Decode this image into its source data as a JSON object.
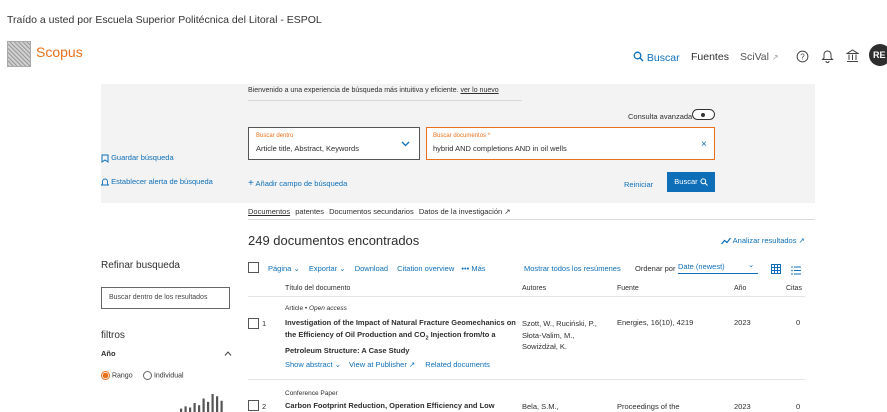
{
  "courtesy": "Traído a usted por Escuela Superior Politécnica del Litoral - ESPOL",
  "brand": {
    "name": "Scopus",
    "accent": "#e9711c",
    "primary": "#0e6fb8"
  },
  "topnav": {
    "search": "Buscar",
    "sources": "Fuentes",
    "scival": "SciVal",
    "scival_arrow": "↗",
    "avatar": "RE"
  },
  "banner": {
    "text": "Bienvenido a una experiencia de búsqueda más intuitiva y eficiente.",
    "link": "ver lo nuevo"
  },
  "advanced": {
    "label": "Consulta avanzada"
  },
  "search": {
    "within_label": "Buscar dentro",
    "within_value": "Article title, Abstract, Keywords",
    "docs_label": "Buscar documentos *",
    "docs_value": "hybrid AND completions AND in oil wells",
    "add_field": "Añadir campo de búsqueda",
    "reset": "Reiniciar",
    "submit": "Buscar"
  },
  "left": {
    "save_search": "Guardar búsqueda",
    "set_alert": "Establecer alerta de búsqueda",
    "refine_title": "Refinar busqueda",
    "refine_placeholder": "Buscar dentro de los resultados",
    "filters": "filtros",
    "year": "Año",
    "range": "Rango",
    "individual": "Individual"
  },
  "tabs": [
    "Documentos",
    "patentes",
    "Documentos secundarios",
    "Datos de la investigación ↗"
  ],
  "results": {
    "count_text": "249 documentos encontrados",
    "analyze": "Analizar resultados ↗",
    "toolbar": {
      "page": "Página",
      "export": "Exportar",
      "download": "Download",
      "citation": "Citation overview",
      "more": "Más",
      "show_all": "Mostrar todos los resúmenes",
      "sort_label": "Ordenar por",
      "sort_value": "Date (newest)"
    },
    "columns": [
      "Título del documento",
      "Autores",
      "Fuente",
      "Año",
      "Citas"
    ],
    "rows": [
      {
        "num": "1",
        "type": "Article",
        "access": "Open access",
        "title_l1": "Investigation of the Impact of Natural Fracture Geomechanics on",
        "title_l2a": "the Efficiency of Oil Production and CO",
        "title_sub": "2",
        "title_l2b": " Injection from/to a",
        "title_l3": "Petroleum Structure: A Case Study",
        "authors_l1": "Szott, W., Ruciński, P.,",
        "authors_l2": "Słota-Valim, M.,",
        "authors_l3": "Sowiżdżał, K.",
        "source": "Energies, 16(10), 4219",
        "year": "2023",
        "cites": "0",
        "show_abstract": "Show abstract",
        "publisher": "View at Publisher ↗",
        "related": "Related documents"
      },
      {
        "num": "2",
        "type": "Conference Paper",
        "title_l1": "Carbon Footprint Reduction, Operation Efficiency and Low",
        "authors_l1": "Bela, S.M.,",
        "source": "Proceedings of the",
        "year": "2023",
        "cites": "0"
      }
    ]
  },
  "histogram": [
    3,
    5,
    4,
    8,
    6,
    12,
    9,
    16,
    14,
    10
  ]
}
